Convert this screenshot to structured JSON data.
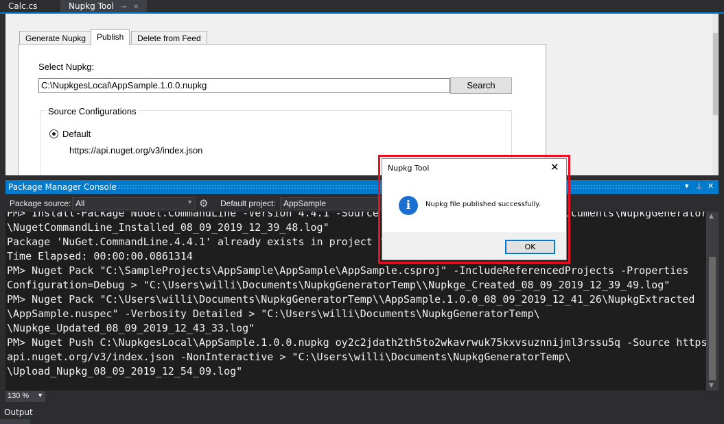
{
  "doc_tabs": [
    {
      "label": "Calc.cs"
    },
    {
      "label": "Nupkg Tool",
      "pin": "⊸",
      "close": "✕"
    }
  ],
  "tool": {
    "tabs": [
      "Generate Nupkg",
      "Publish",
      "Delete from Feed"
    ],
    "active_tab": "Publish",
    "select_label": "Select Nupkg:",
    "path_value": "C:\\NupkgesLocal\\AppSample.1.0.0.nupkg",
    "search_button": "Search",
    "source_group_title": "Source Configurations",
    "source_option": "Default",
    "source_selected": true,
    "source_url": "https://api.nuget.org/v3/index.json"
  },
  "pmc": {
    "title": "Package Manager Console",
    "ctrl_dropdown": "▾",
    "ctrl_pin": "⊥",
    "ctrl_close": "✕",
    "source_label": "Package source:",
    "source_value": "All",
    "project_label": "Default project:",
    "project_value": "AppSample",
    "lines": [
      "PM> Install-Package NuGet.CommandLine -Version 4.4.1 -Source nuget.org > \"C:\\Users\\willi\\Documents\\NupkgGeneratorTemp\\",
      "\\NugetCommandLine_Installed_08_09_2019_12_39_48.log\"",
      "Package 'NuGet.CommandLine.4.4.1' already exists in project 'AppSample'",
      "Time Elapsed: 00:00:00.0861314",
      "PM> Nuget Pack \"C:\\SampleProjects\\AppSample\\AppSample\\AppSample.csproj\" -IncludeReferencedProjects -Properties",
      "Configuration=Debug > \"C:\\Users\\willi\\Documents\\NupkgGeneratorTemp\\\\Nupkge_Created_08_09_2019_12_39_49.log\"",
      "PM> Nuget Pack \"C:\\Users\\willi\\Documents\\NupkgGeneratorTemp\\\\AppSample.1.0.0_08_09_2019_12_41_26\\NupkgExtracted",
      "\\AppSample.nuspec\" -Verbosity Detailed > \"C:\\Users\\willi\\Documents\\NupkgGeneratorTemp\\",
      "\\Nupkge_Updated_08_09_2019_12_43_33.log\"",
      "PM> Nuget Push C:\\NupkgesLocal\\AppSample.1.0.0.nupkg oy2c2jdath2th5to2wkavrwuk75kxvsuznnijml3rssu5q -Source https://",
      "api.nuget.org/v3/index.json -NonInteractive > \"C:\\Users\\willi\\Documents\\NupkgGeneratorTemp\\",
      "\\Upload_Nupkg_08_09_2019_12_54_09.log\""
    ],
    "zoom": "130 %",
    "output_tab": "Output"
  },
  "dialog": {
    "title": "Nupkg Tool",
    "close": "✕",
    "icon": "info-icon",
    "icon_glyph": "i",
    "message": "Nupkg file published successfully.",
    "ok": "OK",
    "highlight_color": "#e81123"
  },
  "colors": {
    "accent": "#007acc",
    "console_bg": "#1e1e1e",
    "ide_bg": "#2d2d30"
  }
}
